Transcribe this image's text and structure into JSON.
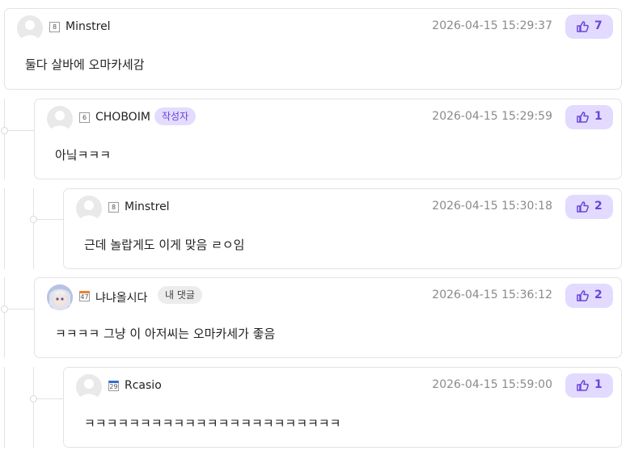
{
  "colors": {
    "accent": "#6a45d8",
    "like_bg": "#e2dbff",
    "author_tag_bg": "#e4dcff",
    "card_border": "#e3e3e3"
  },
  "comments": [
    {
      "level": "8",
      "level_style": "plain",
      "nickname": "Minstrel",
      "tag": "",
      "timestamp": "2026-04-15 15:29:37",
      "likes": "7",
      "text": "둘다 살바에 오마카세감",
      "avatar": "default-avatar-icon"
    },
    {
      "level": "6",
      "level_style": "plain",
      "nickname": "CHOBOIM",
      "tag": "작성자",
      "timestamp": "2026-04-15 15:29:59",
      "likes": "1",
      "text": "아닠ㅋㅋㅋ",
      "avatar": "default-avatar-icon"
    },
    {
      "level": "8",
      "level_style": "plain",
      "nickname": "Minstrel",
      "tag": "",
      "timestamp": "2026-04-15 15:30:18",
      "likes": "2",
      "text": "근데 놀랍게도 이게 맞음 ㄹㅇ임",
      "avatar": "default-avatar-icon"
    },
    {
      "level": "47",
      "level_style": "orange",
      "nickname": "냐냐올시다",
      "tag": "내 댓글",
      "timestamp": "2026-04-15 15:36:12",
      "likes": "2",
      "text": "ㅋㅋㅋㅋ 그냥 이 아저씨는 오마카세가 좋음",
      "avatar": "anime-character-avatar-icon"
    },
    {
      "level": "29",
      "level_style": "blue",
      "nickname": "Rcasio",
      "tag": "",
      "timestamp": "2026-04-15 15:59:00",
      "likes": "1",
      "text": "ㅋㅋㅋㅋㅋㅋㅋㅋㅋㅋㅋㅋㅋㅋㅋㅋㅋㅋㅋㅋㅋㅋㅋ",
      "avatar": "default-avatar-icon"
    }
  ]
}
